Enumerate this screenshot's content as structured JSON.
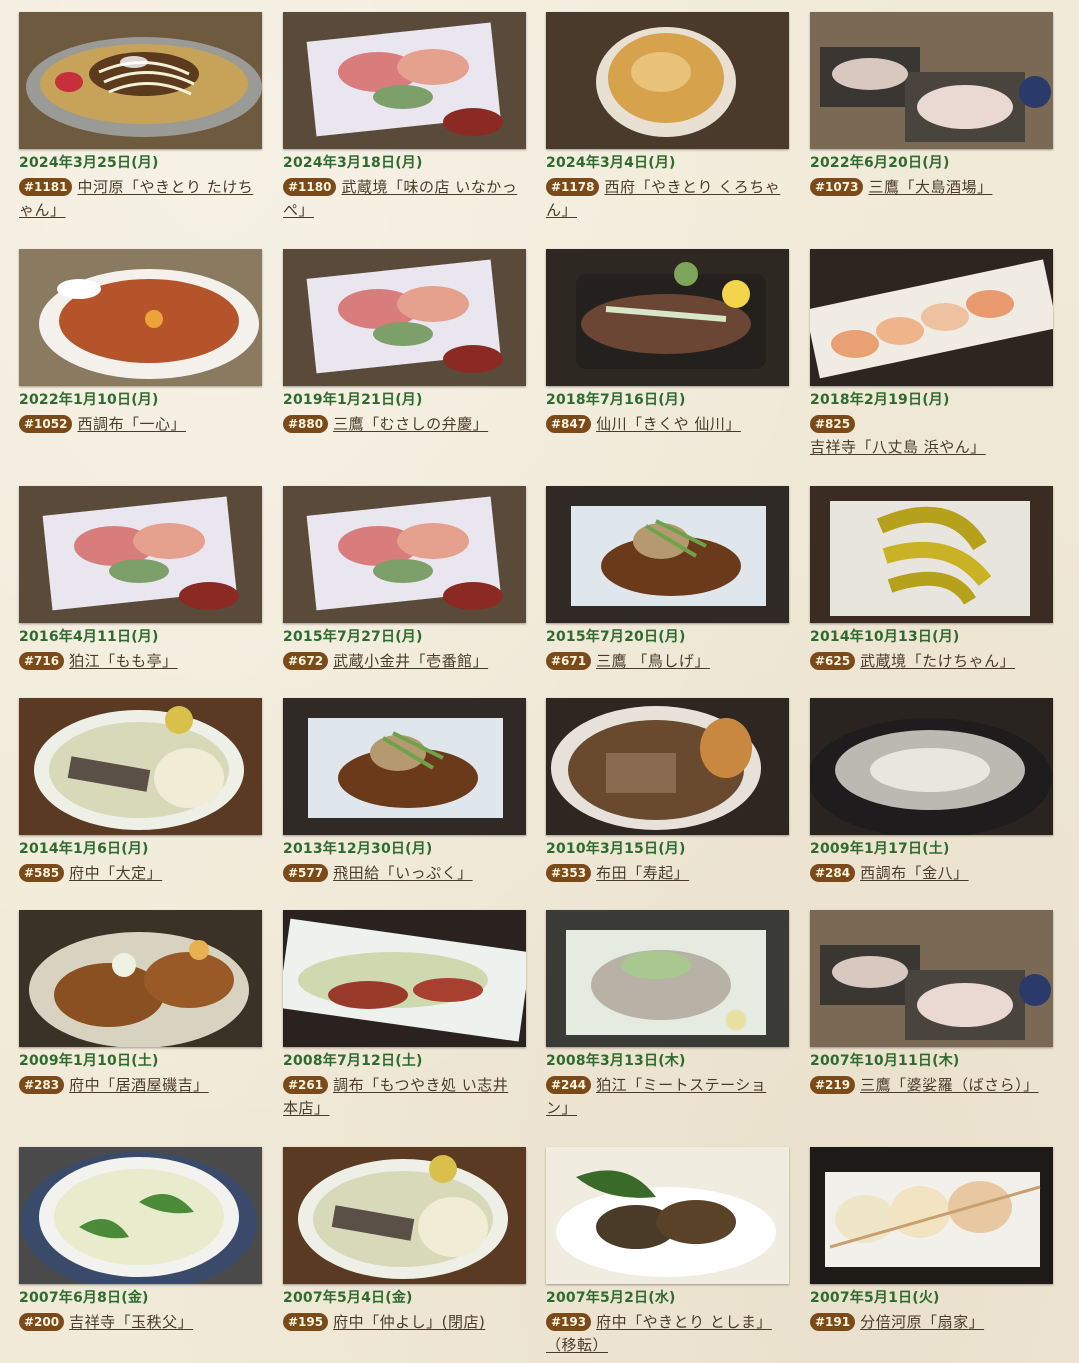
{
  "episodes": [
    {
      "date": "2024年3月25日(月)",
      "number": "#1181",
      "title": "中河原「やきとり たけちゃん」",
      "image": "okonomiyaki-plate"
    },
    {
      "date": "2024年3月18日(月)",
      "number": "#1180",
      "title": "武蔵境「味の店 いなかっぺ」",
      "image": "sashimi-platter"
    },
    {
      "date": "2024年3月4日(月)",
      "number": "#1178",
      "title": "西府「やきとり くろちゃん」",
      "image": "gratin-dish"
    },
    {
      "date": "2022年6月20日(月)",
      "number": "#1073",
      "title": "三鷹「大島酒場」",
      "image": "sashimi-slices"
    },
    {
      "date": "2022年1月10日(月)",
      "number": "#1052",
      "title": "西調布「一心」",
      "image": "curry-bowl"
    },
    {
      "date": "2019年1月21日(月)",
      "number": "#880",
      "title": "三鷹「むさしの弁慶」",
      "image": "sashimi-platter"
    },
    {
      "date": "2018年7月16日(月)",
      "number": "#847",
      "title": "仙川「きくや 仙川」",
      "image": "tataki-plate"
    },
    {
      "date": "2018年2月19日(月)",
      "number": "#825",
      "title": "吉祥寺「八丈島 浜やん」",
      "image": "sushi-row"
    },
    {
      "date": "2016年4月11日(月)",
      "number": "#716",
      "title": "狛江「もも亭」",
      "image": "sashimi-platter"
    },
    {
      "date": "2015年7月27日(月)",
      "number": "#672",
      "title": "武蔵小金井「壱番館」",
      "image": "sashimi-platter"
    },
    {
      "date": "2015年7月20日(月)",
      "number": "#671",
      "title": "三鷹 「鳥しげ」",
      "image": "simmered-fish"
    },
    {
      "date": "2014年10月13日(月)",
      "number": "#625",
      "title": "武蔵境「たけちゃん」",
      "image": "corn-pieces"
    },
    {
      "date": "2014年1月6日(月)",
      "number": "#585",
      "title": "府中「大定」",
      "image": "oden-bowl"
    },
    {
      "date": "2013年12月30日(月)",
      "number": "#577",
      "title": "飛田給「いっぷく」",
      "image": "simmered-fish"
    },
    {
      "date": "2010年3月15日(月)",
      "number": "#353",
      "title": "布田「寿起」",
      "image": "stew-bowl"
    },
    {
      "date": "2009年1月17日(土)",
      "number": "#284",
      "title": "西調布「金八」",
      "image": "fugu-sashimi"
    },
    {
      "date": "2009年1月10日(土)",
      "number": "#283",
      "title": "府中「居酒屋磯吉」",
      "image": "fried-chicken"
    },
    {
      "date": "2008年7月12日(土)",
      "number": "#261",
      "title": "調布「もつやき処 い志井 本店」",
      "image": "negi-tataki"
    },
    {
      "date": "2008年3月13日(木)",
      "number": "#244",
      "title": "狛江「ミートステーション」",
      "image": "motsu-plate"
    },
    {
      "date": "2007年10月11日(木)",
      "number": "#219",
      "title": "三鷹「婆娑羅（ばさら）」",
      "image": "sashimi-slices"
    },
    {
      "date": "2007年6月8日(金)",
      "number": "#200",
      "title": "吉祥寺「玉秩父」",
      "image": "chawanmushi"
    },
    {
      "date": "2007年5月4日(金)",
      "number": "#195",
      "title": "府中「仲よし」(閉店)",
      "image": "oden-bowl"
    },
    {
      "date": "2007年5月2日(水)",
      "number": "#193",
      "title": "府中「やきとり としま」（移転）",
      "image": "grilled-liver"
    },
    {
      "date": "2007年5月1日(火)",
      "number": "#191",
      "title": "分倍河原「扇家」",
      "image": "grilled-scallops"
    }
  ],
  "colors": {
    "background": "#f1ead8",
    "date_text": "#2e6b2e",
    "badge": "#7b4a1b",
    "link_text": "#4a3b2a"
  }
}
